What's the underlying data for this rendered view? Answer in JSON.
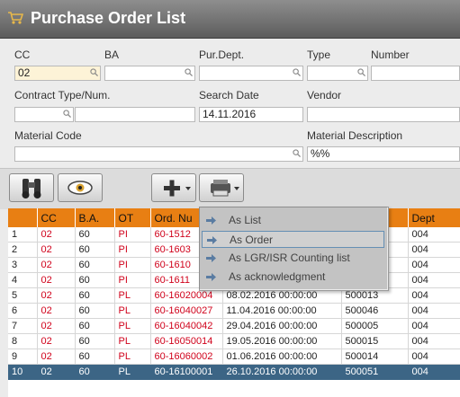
{
  "window": {
    "title": "Purchase Order List"
  },
  "filters": {
    "cc_label": "CC",
    "cc_value": "02",
    "ba_label": "BA",
    "ba_value": "",
    "purdept_label": "Pur.Dept.",
    "purdept_value": "",
    "type_label": "Type",
    "type_value": "",
    "number_label": "Number",
    "number_value": "",
    "contract_label": "Contract Type/Num.",
    "contract_type_value": "",
    "contract_num_value": "",
    "searchdate_label": "Search Date",
    "searchdate_value": "14.11.2016",
    "vendor_label": "Vendor",
    "vendor_value": "",
    "material_code_label": "Material Code",
    "material_code_value": "",
    "material_desc_label": "Material Description",
    "material_desc_value": "%%"
  },
  "table": {
    "columns": [
      "",
      "CC",
      "B.A.",
      "OT",
      "Ord. Nu",
      "",
      "",
      "Dept"
    ],
    "rows": [
      [
        "1",
        "02",
        "60",
        "PI",
        "60-1512",
        "",
        "",
        "004"
      ],
      [
        "2",
        "02",
        "60",
        "PI",
        "60-1603",
        "",
        "",
        "004"
      ],
      [
        "3",
        "02",
        "60",
        "PI",
        "60-1610",
        "",
        "",
        "004"
      ],
      [
        "4",
        "02",
        "60",
        "PI",
        "60-1611",
        "",
        "",
        "004"
      ],
      [
        "5",
        "02",
        "60",
        "PL",
        "60-16020004",
        "08.02.2016 00:00:00",
        "500013",
        "004"
      ],
      [
        "6",
        "02",
        "60",
        "PL",
        "60-16040027",
        "11.04.2016 00:00:00",
        "500046",
        "004"
      ],
      [
        "7",
        "02",
        "60",
        "PL",
        "60-16040042",
        "29.04.2016 00:00:00",
        "500005",
        "004"
      ],
      [
        "8",
        "02",
        "60",
        "PL",
        "60-16050014",
        "19.05.2016 00:00:00",
        "500015",
        "004"
      ],
      [
        "9",
        "02",
        "60",
        "PL",
        "60-16060002",
        "01.06.2016 00:00:00",
        "500014",
        "004"
      ],
      [
        "10",
        "02",
        "60",
        "PL",
        "60-16100001",
        "26.10.2016 00:00:00",
        "500051",
        "004"
      ]
    ],
    "selected_row": 9
  },
  "print_menu": {
    "items": [
      "As List",
      "As Order",
      "As LGR/ISR Counting list",
      "As acknowledgment"
    ],
    "selected_index": 1
  },
  "colors": {
    "header_orange": "#e87f13",
    "selected_row": "#3c6585",
    "red_text": "#d0021b"
  },
  "icons": [
    "cart-icon",
    "binoculars-icon",
    "eye-icon",
    "plus-icon",
    "printer-icon",
    "magnifier-icon",
    "arrow-icon"
  ]
}
